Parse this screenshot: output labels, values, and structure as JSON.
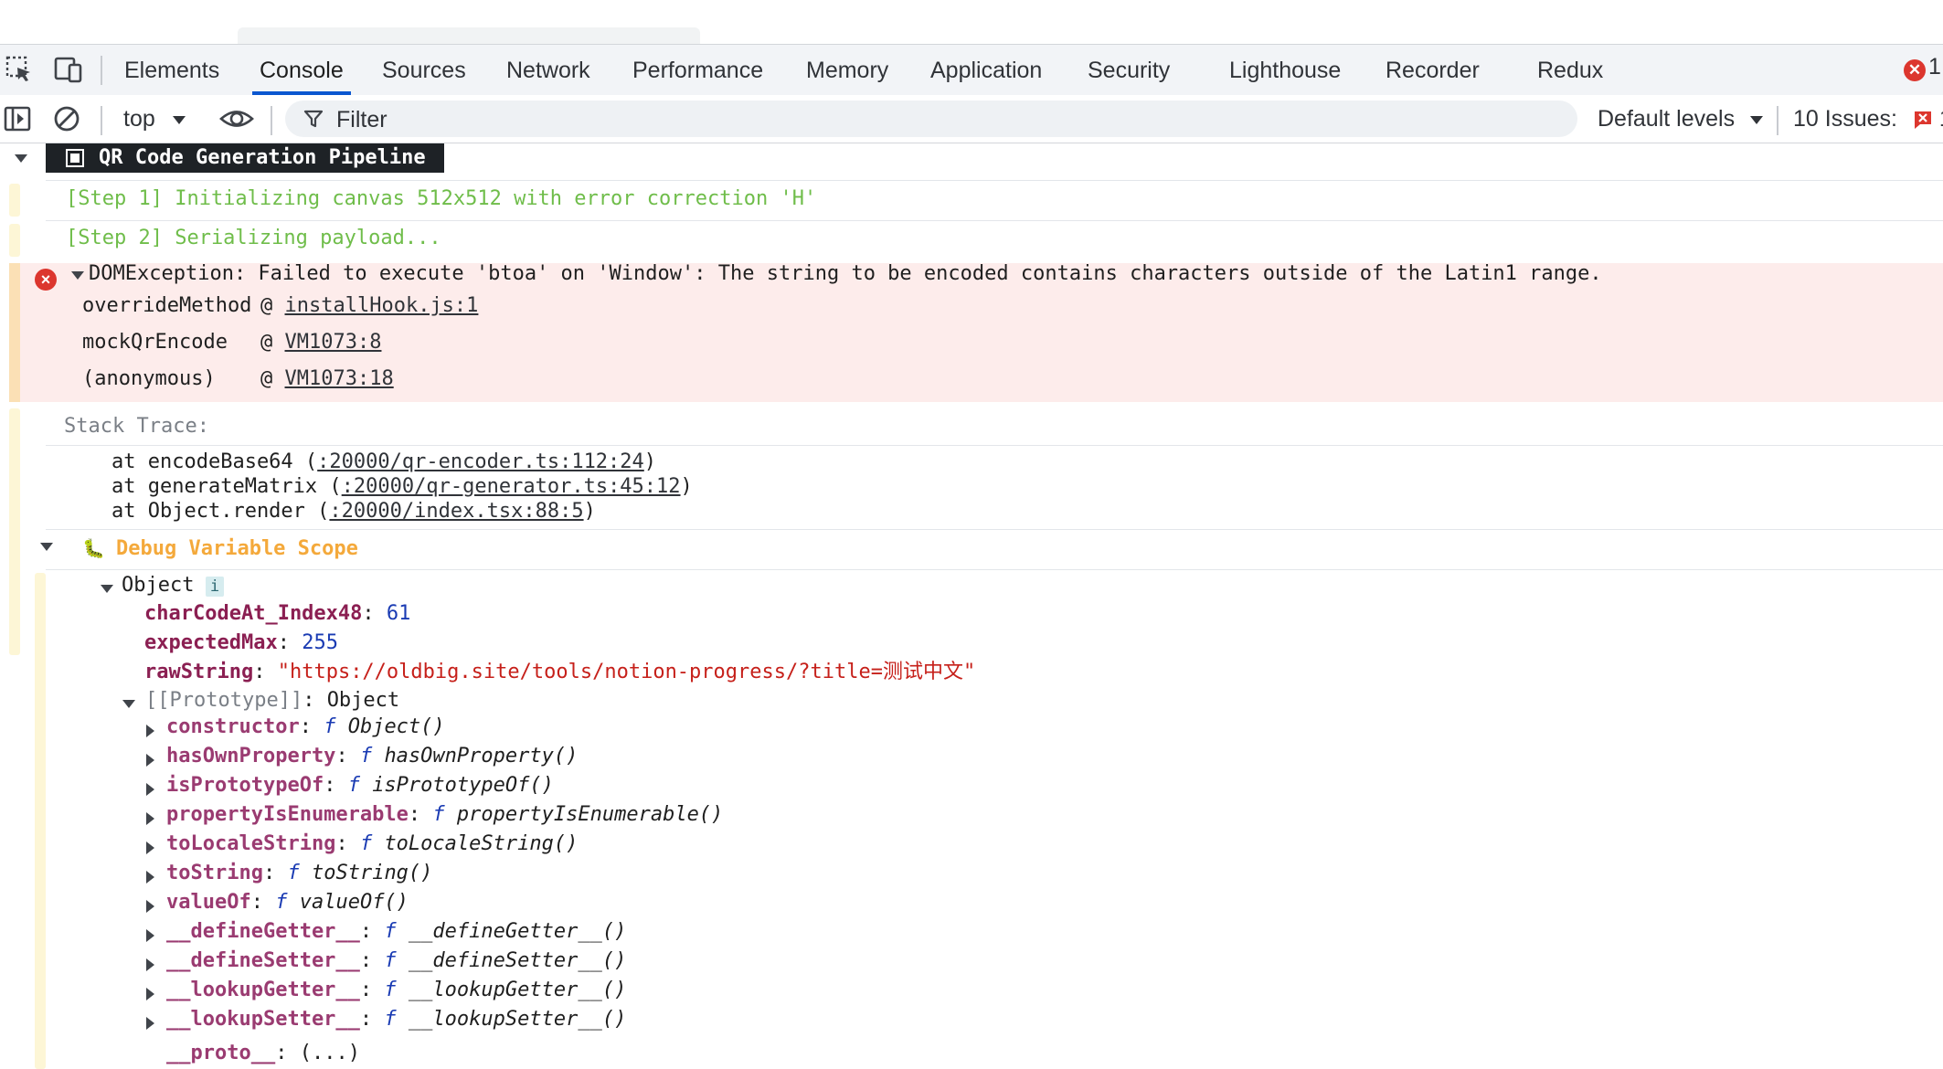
{
  "colors": {
    "accent": "#0b57d0",
    "error_badge": "#dc362e",
    "error_bg": "#fdeceb",
    "step_green": "#6fbd4a",
    "group_title_orange": "#f4a93b",
    "key_purple": "#8b1f52",
    "string_red": "#c6201a",
    "number_blue": "#1a3bb3"
  },
  "tabs": [
    "Elements",
    "Console",
    "Sources",
    "Network",
    "Performance",
    "Memory",
    "Application",
    "Security",
    "Lighthouse",
    "Recorder",
    "Redux"
  ],
  "active_tab": "Console",
  "tabbar": {
    "error_count": "1",
    "error_glyph": "✕"
  },
  "toolbar": {
    "context": "top",
    "filter_placeholder": "Filter",
    "levels": "Default levels",
    "issues_label": "10 Issues:",
    "issues_count": "1"
  },
  "group": {
    "title": "QR Code Generation Pipeline"
  },
  "steps": [
    "[Step 1] Initializing canvas 512x512 with error correction 'H'",
    "[Step 2] Serializing payload..."
  ],
  "error": {
    "message": "DOMException: Failed to execute 'btoa' on 'Window': The string to be encoded contains characters outside of the Latin1 range.",
    "frames": [
      {
        "fn": "overrideMethod",
        "at": "@",
        "link": "installHook.js:1"
      },
      {
        "fn": "mockQrEncode",
        "at": "@",
        "link": "VM1073:8"
      },
      {
        "fn": "(anonymous)",
        "at": "@",
        "link": "VM1073:18"
      }
    ]
  },
  "stack": {
    "label": "Stack Trace:",
    "lines": [
      {
        "prefix": "at encodeBase64 (",
        "link": ":20000/qr-encoder.ts:112:24",
        "suffix": ")"
      },
      {
        "prefix": "at generateMatrix (",
        "link": ":20000/qr-generator.ts:45:12",
        "suffix": ")"
      },
      {
        "prefix": "at Object.render (",
        "link": ":20000/index.tsx:88:5",
        "suffix": ")"
      }
    ]
  },
  "debug_group": {
    "emoji": "🐛",
    "title": "Debug Variable Scope",
    "object_label": "Object",
    "info": "i",
    "props": [
      {
        "key": "charCodeAt_Index48",
        "sep": ": ",
        "value": "61",
        "kind": "num"
      },
      {
        "key": "expectedMax",
        "sep": ": ",
        "value": "255",
        "kind": "num"
      },
      {
        "key": "rawString",
        "sep": ": ",
        "value": "\"https://oldbig.site/tools/notion-progress/?title=测试中文\"",
        "kind": "str"
      }
    ],
    "prototype_label": "[[Prototype]]",
    "prototype_value": "Object",
    "proto_entries": [
      {
        "key": "constructor",
        "name": "Object()"
      },
      {
        "key": "hasOwnProperty",
        "name": "hasOwnProperty()"
      },
      {
        "key": "isPrototypeOf",
        "name": "isPrototypeOf()"
      },
      {
        "key": "propertyIsEnumerable",
        "name": "propertyIsEnumerable()"
      },
      {
        "key": "toLocaleString",
        "name": "toLocaleString()"
      },
      {
        "key": "toString",
        "name": "toString()"
      },
      {
        "key": "valueOf",
        "name": "valueOf()"
      },
      {
        "key": "__defineGetter__",
        "name": "__defineGetter__()"
      },
      {
        "key": "__defineSetter__",
        "name": "__defineSetter__()"
      },
      {
        "key": "__lookupGetter__",
        "name": "__lookupGetter__()"
      },
      {
        "key": "__lookupSetter__",
        "name": "__lookupSetter__()"
      }
    ],
    "fn_glyph": "f",
    "proto_key": "__proto__",
    "proto_val": "(...)"
  }
}
